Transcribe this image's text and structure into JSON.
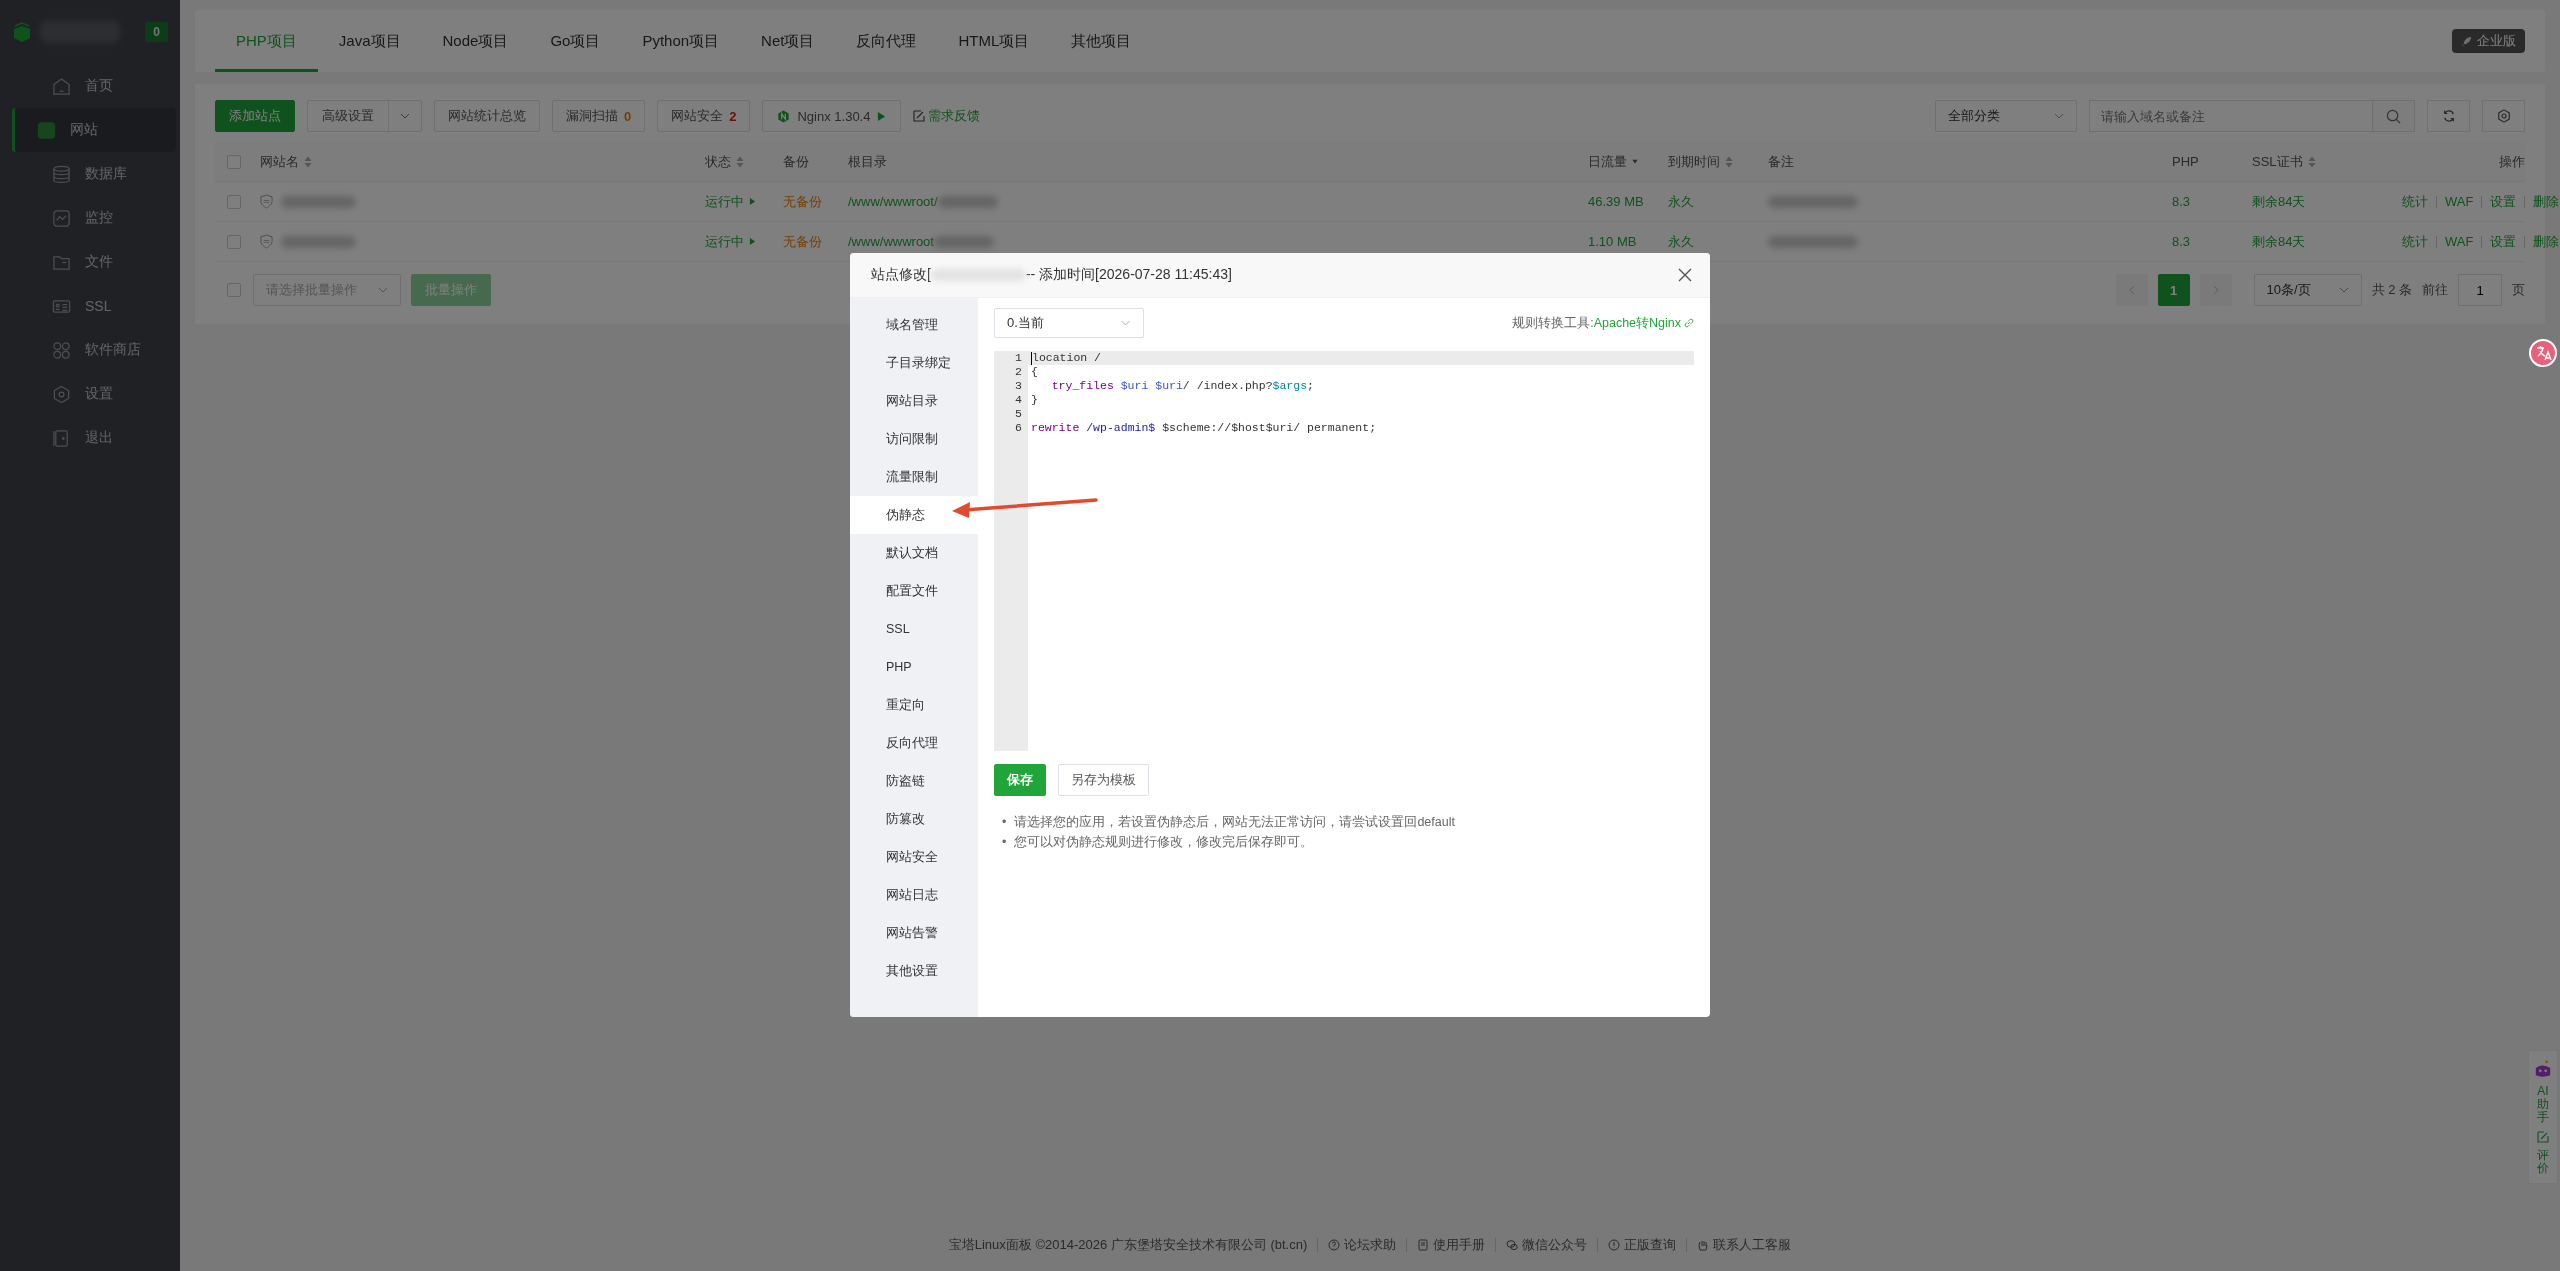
{
  "sidebar": {
    "badge": "0",
    "items": [
      {
        "label": "首页",
        "selected": false
      },
      {
        "label": "网站",
        "selected": true
      },
      {
        "label": "数据库",
        "selected": false
      },
      {
        "label": "监控",
        "selected": false
      },
      {
        "label": "文件",
        "selected": false
      },
      {
        "label": "SSL",
        "selected": false
      },
      {
        "label": "软件商店",
        "selected": false
      },
      {
        "label": "设置",
        "selected": false
      },
      {
        "label": "退出",
        "selected": false
      }
    ]
  },
  "tabs": [
    {
      "label": "PHP项目",
      "selected": true
    },
    {
      "label": "Java项目",
      "selected": false
    },
    {
      "label": "Node项目",
      "selected": false
    },
    {
      "label": "Go项目",
      "selected": false
    },
    {
      "label": "Python项目",
      "selected": false
    },
    {
      "label": "Net项目",
      "selected": false
    },
    {
      "label": "反向代理",
      "selected": false
    },
    {
      "label": "HTML项目",
      "selected": false
    },
    {
      "label": "其他项目",
      "selected": false
    }
  ],
  "edition_badge": "企业版",
  "toolbar": {
    "buttons": [
      {
        "kind": "primary",
        "label": "添加站点"
      },
      {
        "kind": "dropdown",
        "label": "高级设置"
      },
      {
        "kind": "plain",
        "label": "网站统计总览"
      },
      {
        "kind": "warning",
        "label": "漏洞扫描",
        "count": "0"
      },
      {
        "kind": "danger",
        "label": "网站安全",
        "count": "2"
      },
      {
        "kind": "nginx",
        "label": "Nginx 1.30.4"
      }
    ],
    "feedback": "需求反馈",
    "category": "全部分类",
    "search_placeholder": "请输入域名或备注"
  },
  "table": {
    "select_all": {
      "checked": false
    },
    "columns": [
      {
        "label": "网站名",
        "kind": "sortable"
      },
      {
        "label": "状态",
        "kind": "sortable"
      },
      {
        "label": "备份",
        "kind": "plain"
      },
      {
        "label": "根目录",
        "kind": "plain"
      },
      {
        "label": "日流量",
        "kind": "sorted"
      },
      {
        "label": "到期时间",
        "kind": "sortable"
      },
      {
        "label": "备注",
        "kind": "plain"
      },
      {
        "label": "PHP",
        "kind": "plain"
      },
      {
        "label": "SSL证书",
        "kind": "sortable"
      },
      {
        "label": "操作",
        "kind": "plain"
      }
    ],
    "rows": [
      {
        "checked": false,
        "status": "运行中",
        "backup": "无备份",
        "root": "/www/wwwroot/",
        "traffic": "46.39 MB",
        "expire": "永久",
        "php": "8.3",
        "ssl": "剩余84天",
        "actions": [
          "统计",
          "WAF",
          "设置",
          "删除"
        ]
      },
      {
        "checked": false,
        "status": "运行中",
        "backup": "无备份",
        "root": "/www/wwwroot",
        "traffic": "1.10 MB",
        "expire": "永久",
        "php": "8.3",
        "ssl": "剩余84天",
        "actions": [
          "统计",
          "WAF",
          "设置",
          "删除"
        ]
      }
    ]
  },
  "batch": {
    "checked": false,
    "placeholder": "请选择批量操作",
    "button": "批量操作"
  },
  "pagination": {
    "pages": [
      {
        "label": "1",
        "selected": true
      }
    ],
    "page_size": "10条/页",
    "total": "共 2 条",
    "goto": "前往",
    "goto_value": "1",
    "suffix": "页"
  },
  "modal": {
    "title_prefix": "站点修改[",
    "title_suffix": "-- 添加时间[2026-07-28 11:45:43]",
    "menu": [
      {
        "label": "域名管理",
        "selected": false
      },
      {
        "label": "子目录绑定",
        "selected": false
      },
      {
        "label": "网站目录",
        "selected": false
      },
      {
        "label": "访问限制",
        "selected": false
      },
      {
        "label": "流量限制",
        "selected": false
      },
      {
        "label": "伪静态",
        "selected": true
      },
      {
        "label": "默认文档",
        "selected": false
      },
      {
        "label": "配置文件",
        "selected": false
      },
      {
        "label": "SSL",
        "selected": false
      },
      {
        "label": "PHP",
        "selected": false
      },
      {
        "label": "重定向",
        "selected": false
      },
      {
        "label": "反向代理",
        "selected": false
      },
      {
        "label": "防盗链",
        "selected": false
      },
      {
        "label": "防篡改",
        "selected": false
      },
      {
        "label": "网站安全",
        "selected": false
      },
      {
        "label": "网站日志",
        "selected": false
      },
      {
        "label": "网站告警",
        "selected": false
      },
      {
        "label": "其他设置",
        "selected": false
      }
    ],
    "template": "0.当前",
    "tool_label": "规则转换工具:",
    "tool_link": "Apache转Nginx",
    "code": [
      {
        "number": "1",
        "active": true,
        "tokens": [
          {
            "kind": "plain",
            "text": "location /"
          }
        ]
      },
      {
        "number": "2",
        "active": false,
        "tokens": [
          {
            "kind": "plain",
            "text": "{"
          }
        ]
      },
      {
        "number": "3",
        "active": false,
        "tokens": [
          {
            "kind": "keyword",
            "text": "   try_files "
          },
          {
            "kind": "variable",
            "text": "$uri "
          },
          {
            "kind": "variable",
            "text": "$uri"
          },
          {
            "kind": "plain",
            "text": "/ /index.php?"
          },
          {
            "kind": "builtin",
            "text": "$args"
          },
          {
            "kind": "plain",
            "text": ";"
          }
        ]
      },
      {
        "number": "4",
        "active": false,
        "tokens": [
          {
            "kind": "plain",
            "text": "}"
          }
        ]
      },
      {
        "number": "5",
        "active": false
      },
      {
        "number": "6",
        "active": false,
        "tokens": [
          {
            "kind": "keyword",
            "text": "rewrite "
          },
          {
            "kind": "string",
            "text": "/wp-admin$"
          },
          {
            "kind": "plain",
            "text": " $scheme://$host$uri/ permanent;"
          }
        ]
      }
    ],
    "save": "保存",
    "save_template": "另存为模板",
    "notes": [
      {
        "bullet": "•",
        "text": "请选择您的应用，若设置伪静态后，网站无法正常访问，请尝试设置回default"
      },
      {
        "bullet": "•",
        "text": "您可以对伪静态规则进行修改，修改完后保存即可。"
      }
    ]
  },
  "footer": {
    "copyright": "宝塔Linux面板 ©2014-2026 广东堡塔安全技术有限公司 (bt.cn)",
    "links": [
      "论坛求助",
      "使用手册",
      "微信公众号",
      "正版查询",
      "联系人工客服"
    ]
  },
  "helper": {
    "ai": "AI助手",
    "review": "评价"
  }
}
